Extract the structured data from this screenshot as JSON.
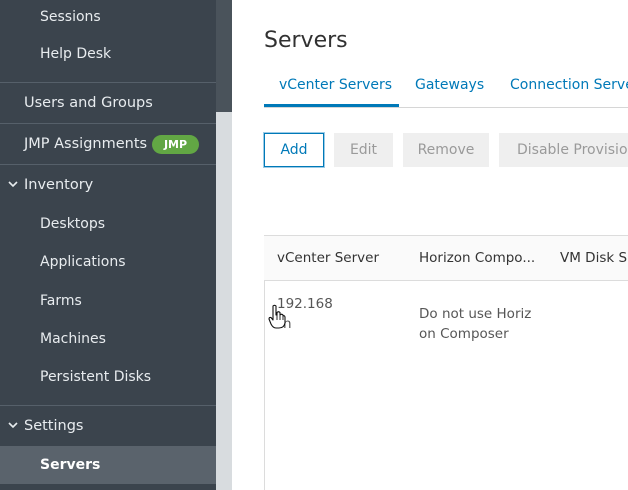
{
  "sidebar": {
    "sessions": "Sessions",
    "help_desk": "Help Desk",
    "users_and_groups": "Users and Groups",
    "jmp_assignments": "JMP Assignments",
    "jmp_badge": "JMP",
    "inventory": "Inventory",
    "inventory_items": [
      "Desktops",
      "Applications",
      "Farms",
      "Machines",
      "Persistent Disks"
    ],
    "settings": "Settings",
    "servers": "Servers"
  },
  "main": {
    "title": "Servers",
    "tabs": [
      "vCenter Servers",
      "Gateways",
      "Connection Servers"
    ],
    "buttons": {
      "add": "Add",
      "edit": "Edit",
      "remove": "Remove",
      "disable": "Disable Provisioning"
    }
  },
  "table": {
    "columns": [
      "vCenter Server",
      "Horizon Compo...",
      "VM Disk Sp"
    ],
    "row": {
      "server_line1": "192.168.\u0000",
      "server_line2": "n",
      "composer_line1": "Do not use Horiz",
      "composer_line2": "on Composer"
    }
  },
  "colors": {
    "sidebar_bg": "#3b444d",
    "accent": "#0079b8",
    "badge_green": "#62a744"
  }
}
